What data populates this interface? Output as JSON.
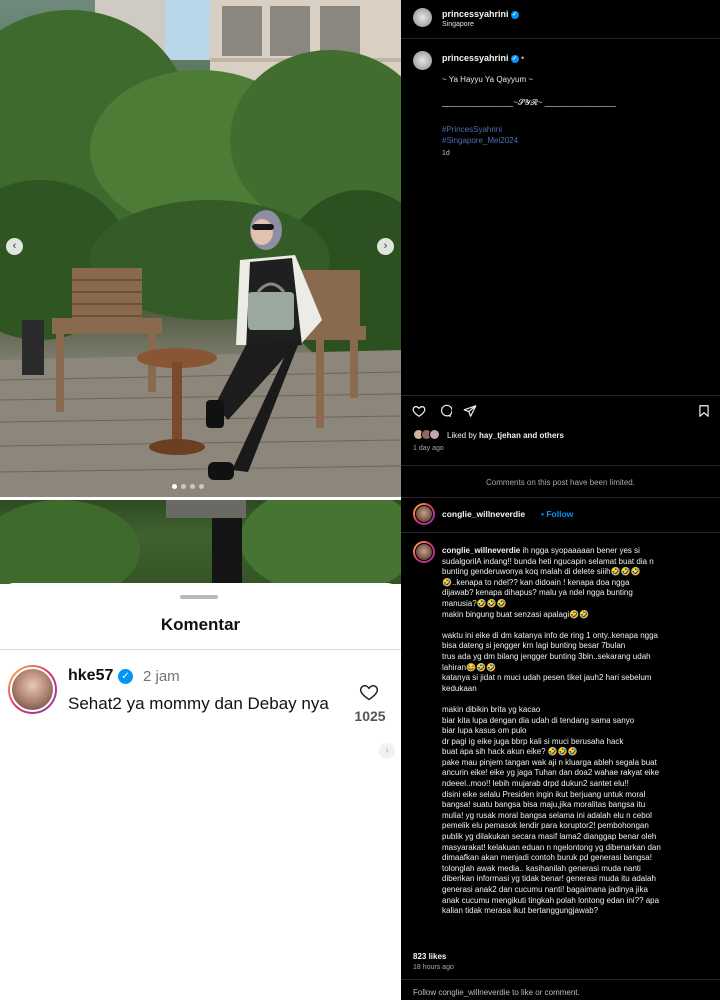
{
  "photo": {
    "prev_arrow": "‹",
    "next_arrow": "›",
    "slide_count": 4,
    "active_slide": 0
  },
  "comments_sheet": {
    "title": "Komentar",
    "comment": {
      "username": "hke57",
      "time": "2 jam",
      "text": "Sehat2 ya mommy dan Debay nya",
      "likes": "1025"
    }
  },
  "post": {
    "username": "princessyahrini",
    "location": "Singapore",
    "caption_separator": "•",
    "caption_line1": "~ Ya Hayyu Ya Qayyum ~",
    "caption_line2": "________________~𝓢𝓨𝓡~ ________________",
    "hashtags": [
      "#PrincesSyahrini",
      "#Singapore_Mei2024"
    ],
    "caption_age": "1d",
    "liked_by_prefix": "Liked by",
    "liked_by_user": "hay_tjehan",
    "liked_by_suffix": "and others",
    "post_age": "1 day ago",
    "limited_notice": "Comments on this post have been limited."
  },
  "commenter": {
    "username": "conglie_willneverdie",
    "separator": "•",
    "follow_label": "Follow",
    "comment_lines": [
      "ih ngga syopaaaaan bener yes si",
      "sudalgorilA indang!! bunda heti ngucapin selamat buat dia n",
      "bunting genderuwonya koq malah di delete siiih🤣🤣🤣",
      "🤣..kenapa to ndel?? kan didoain ! kenapa doa ngga",
      "dijawab? kenapa dihapus? malu ya ndel ngga bunting",
      "manusia?🤣🤣🤣",
      "makin bingung buat senzasi apalagi🤣🤣",
      "",
      "waktu ini eike di dm katanya info de ring 1 onty..kenapa ngga",
      "bisa dateng si jengger krn lagi bunting besar 7bulan",
      "trus ada yg dm bilang jengger bunting 3bln..sekarang udah",
      "lahiran😂🤣🤣",
      "katanya si jidat n muci udah pesen tiket jauh2 hari sebelum",
      "kedukaan",
      "",
      "makin dibikin brita yg kacao",
      "biar kita lupa dengan dia udah di tendang sama sanyo",
      "biar lupa kasus om pulo",
      "dr pagi ig eike juga bbrp kali si muci berusaha hack",
      "buat apa sih hack akun eike? 🤣🤣🤣",
      "pake mau pinjem tangan wak aji n kluarga ableh segala buat",
      "ancurin eike! eike yg jaga Tuhan dan doa2 wahae rakyat eike",
      "ndeeel..moo!! lebih mujarab drpd dukun2 santet elu!!",
      "disini eike selalu Presiden ingin ikut berjuang untuk moral",
      "bangsa! suatu bangsa bisa maju,jika moralitas bangsa itu",
      "mulia! yg rusak moral bangsa selama ini adalah elu n cebol",
      "pemelik elu pemasok lendir para koruptor2! pembohongan",
      "publik yg dilakukan secara masif lama2 dianggap benar oleh",
      "masyarakat! kelakuan eduan n ngelontong yg dibenarkan dan",
      "dimaafkan akan menjadi contoh buruk pd generasi bangsa!",
      "tolonglah awak media.. kasihanilah generasi muda nanti",
      "diberikan informasi yg tidak benar! generasi muda itu adalah",
      "generasi anak2 dan cucumu nanti! bagaimana jadinya jika",
      "anak cucumu mengikuti tingkah polah lontong edan ini?? apa",
      "kalian tidak merasa ikut bertanggungjawab?"
    ],
    "likes": "823 likes",
    "age": "18 hours ago",
    "footer": "Follow conglie_willneverdie to like or comment."
  },
  "colors": {
    "panel_bg": "#000000",
    "link_blue": "#0095f6",
    "hashtag_blue": "#4a6fb0",
    "verified_blue": "#0095f6"
  },
  "icons": [
    "heart-icon",
    "comment-icon",
    "share-icon",
    "bookmark-icon",
    "verified-icon",
    "chevron-left-icon",
    "chevron-right-icon"
  ]
}
